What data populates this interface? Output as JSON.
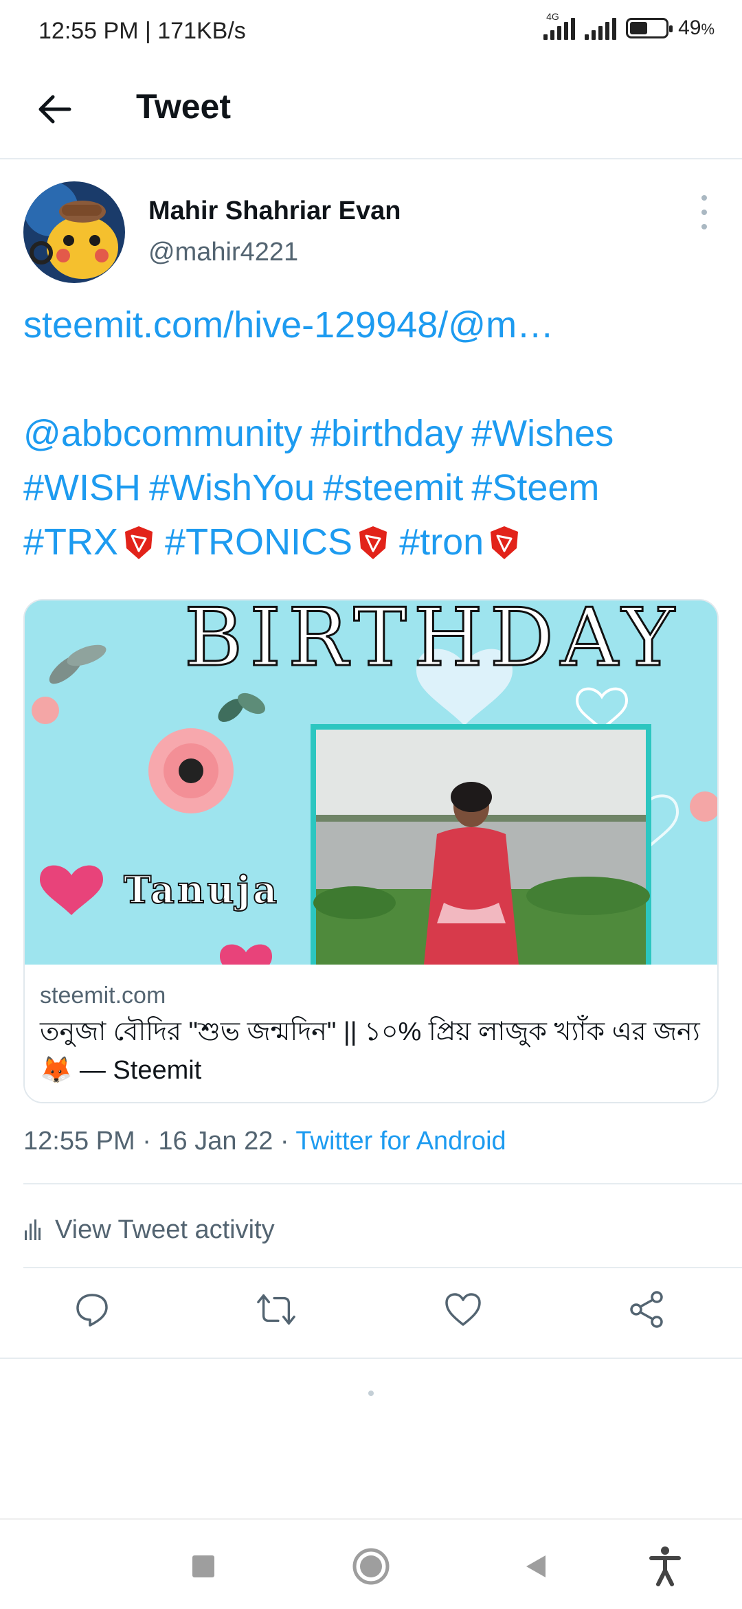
{
  "status_bar": {
    "time_speed": "12:55 PM | 171KB/s",
    "network": "4G",
    "battery_percent": "49",
    "battery_unit": "%",
    "battery_level": 0.49
  },
  "header": {
    "title": "Tweet"
  },
  "tweet": {
    "author_name": "Mahir Shahriar Evan",
    "author_handle": "@mahir4221",
    "link_text": "steemit.com/hive-129948/@m…",
    "mention": "@abbcommunity",
    "hashtags_line1": [
      "#birthday",
      "#Wishes"
    ],
    "hashtags_line2": [
      "#WISH",
      "#WishYou",
      "#steemit",
      "#Steem"
    ],
    "hashtags_line3": [
      "#TRX",
      "#TRONICS",
      "#tron"
    ],
    "timestamp": "12:55 PM · 16 Jan 22 · ",
    "source": "Twitter for Android"
  },
  "card": {
    "image_heading": "BIRTHDAY",
    "image_name": "Tanuja",
    "domain": "steemit.com",
    "title": "তনুজা বৌদির \"শুভ জন্মদিন\" || ১০% প্রিয় লাজুক খ্যাঁক এর জন্য 🦊 — Steemit"
  },
  "activity": {
    "label": "View Tweet activity"
  },
  "colors": {
    "link_blue": "#1d9bf0",
    "secondary_text": "#536471",
    "card_bg": "#9ee4ee",
    "tron_red": "#e2231a"
  }
}
